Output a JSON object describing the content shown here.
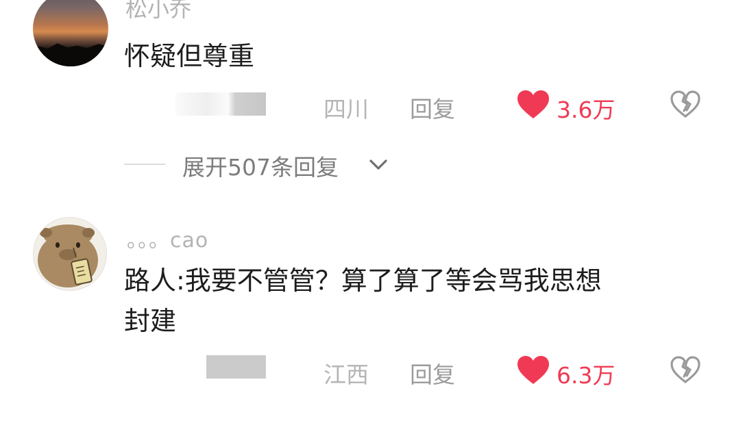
{
  "comments": [
    {
      "username": "松小乔",
      "text_lines": [
        "怀疑但尊重"
      ],
      "location": "四川",
      "reply_label": "回复",
      "likes": "3.6万",
      "replies": {
        "expand_label": "展开507条回复"
      }
    },
    {
      "username": "。。。cao",
      "text_lines": [
        "路人:我要不管管？算了算了等会骂我思想",
        "封建"
      ],
      "location": "江西",
      "reply_label": "回复",
      "likes": "6.3万"
    }
  ],
  "icons": {
    "like": "heart-filled-icon",
    "dislike": "broken-heart-icon",
    "expand": "chevron-down-icon"
  },
  "colors": {
    "like": "#f03a55",
    "meta_text": "#9e9e9e",
    "body_text": "#1d1d1d"
  }
}
